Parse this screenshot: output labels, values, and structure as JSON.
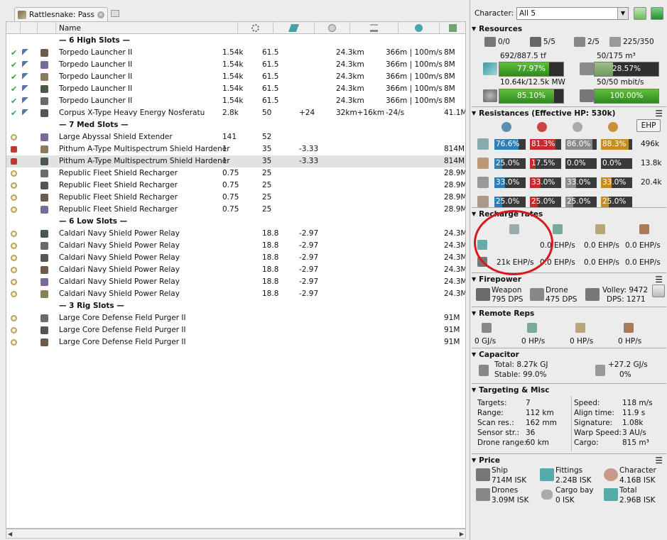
{
  "tab": {
    "title": "Rattlesnake: Pass"
  },
  "grid": {
    "columns": {
      "name": "Name"
    },
    "rows": [
      {
        "type": "header",
        "name": "— 6 High Slots —"
      },
      {
        "type": "mod",
        "state": "check",
        "name": "Torpedo Launcher II",
        "c1": "1.54k",
        "c2": "61.5",
        "c3": "",
        "c4": "24.3km",
        "c5": "366m | 100m/s",
        "c6": "8M"
      },
      {
        "type": "mod",
        "state": "check",
        "name": "Torpedo Launcher II",
        "c1": "1.54k",
        "c2": "61.5",
        "c3": "",
        "c4": "24.3km",
        "c5": "366m | 100m/s",
        "c6": "8M"
      },
      {
        "type": "mod",
        "state": "check",
        "name": "Torpedo Launcher II",
        "c1": "1.54k",
        "c2": "61.5",
        "c3": "",
        "c4": "24.3km",
        "c5": "366m | 100m/s",
        "c6": "8M"
      },
      {
        "type": "mod",
        "state": "check",
        "name": "Torpedo Launcher II",
        "c1": "1.54k",
        "c2": "61.5",
        "c3": "",
        "c4": "24.3km",
        "c5": "366m | 100m/s",
        "c6": "8M"
      },
      {
        "type": "mod",
        "state": "check",
        "name": "Torpedo Launcher II",
        "c1": "1.54k",
        "c2": "61.5",
        "c3": "",
        "c4": "24.3km",
        "c5": "366m | 100m/s",
        "c6": "8M"
      },
      {
        "type": "mod",
        "state": "check",
        "name": "Corpus X-Type Heavy Energy Nosferatu",
        "c1": "2.8k",
        "c2": "50",
        "c3": "+24",
        "c4": "32km+16km",
        "c5": "-24/s",
        "c6": "41.1M"
      },
      {
        "type": "header",
        "name": "— 7 Med Slots —"
      },
      {
        "type": "mod",
        "state": "online",
        "name": "Large Abyssal Shield Extender",
        "c1": "141",
        "c2": "52",
        "c3": "",
        "c4": "",
        "c5": "",
        "c6": ""
      },
      {
        "type": "mod",
        "state": "active",
        "name": "Pithum A-Type Multispectrum Shield Hardener",
        "c1": "1",
        "c2": "35",
        "c3": "-3.33",
        "c4": "",
        "c5": "",
        "c6": "814M"
      },
      {
        "type": "mod",
        "state": "active",
        "selected": true,
        "name": "Pithum A-Type Multispectrum Shield Hardener",
        "c1": "1",
        "c2": "35",
        "c3": "-3.33",
        "c4": "",
        "c5": "",
        "c6": "814M"
      },
      {
        "type": "mod",
        "state": "online",
        "name": "Republic Fleet Shield Recharger",
        "c1": "0.75",
        "c2": "25",
        "c3": "",
        "c4": "",
        "c5": "",
        "c6": "28.9M"
      },
      {
        "type": "mod",
        "state": "online",
        "name": "Republic Fleet Shield Recharger",
        "c1": "0.75",
        "c2": "25",
        "c3": "",
        "c4": "",
        "c5": "",
        "c6": "28.9M"
      },
      {
        "type": "mod",
        "state": "online",
        "name": "Republic Fleet Shield Recharger",
        "c1": "0.75",
        "c2": "25",
        "c3": "",
        "c4": "",
        "c5": "",
        "c6": "28.9M"
      },
      {
        "type": "mod",
        "state": "online",
        "name": "Republic Fleet Shield Recharger",
        "c1": "0.75",
        "c2": "25",
        "c3": "",
        "c4": "",
        "c5": "",
        "c6": "28.9M"
      },
      {
        "type": "header",
        "name": "— 6 Low Slots —"
      },
      {
        "type": "mod",
        "state": "online",
        "name": "Caldari Navy Shield Power Relay",
        "c1": "",
        "c2": "18.8",
        "c3": "-2.97",
        "c4": "",
        "c5": "",
        "c6": "24.3M"
      },
      {
        "type": "mod",
        "state": "online",
        "name": "Caldari Navy Shield Power Relay",
        "c1": "",
        "c2": "18.8",
        "c3": "-2.97",
        "c4": "",
        "c5": "",
        "c6": "24.3M"
      },
      {
        "type": "mod",
        "state": "online",
        "name": "Caldari Navy Shield Power Relay",
        "c1": "",
        "c2": "18.8",
        "c3": "-2.97",
        "c4": "",
        "c5": "",
        "c6": "24.3M"
      },
      {
        "type": "mod",
        "state": "online",
        "name": "Caldari Navy Shield Power Relay",
        "c1": "",
        "c2": "18.8",
        "c3": "-2.97",
        "c4": "",
        "c5": "",
        "c6": "24.3M"
      },
      {
        "type": "mod",
        "state": "online",
        "name": "Caldari Navy Shield Power Relay",
        "c1": "",
        "c2": "18.8",
        "c3": "-2.97",
        "c4": "",
        "c5": "",
        "c6": "24.3M"
      },
      {
        "type": "mod",
        "state": "online",
        "name": "Caldari Navy Shield Power Relay",
        "c1": "",
        "c2": "18.8",
        "c3": "-2.97",
        "c4": "",
        "c5": "",
        "c6": "24.3M"
      },
      {
        "type": "header",
        "name": "— 3 Rig Slots —"
      },
      {
        "type": "mod",
        "state": "online",
        "name": "Large Core Defense Field Purger II",
        "c1": "",
        "c2": "",
        "c3": "",
        "c4": "",
        "c5": "",
        "c6": "91M"
      },
      {
        "type": "mod",
        "state": "online",
        "name": "Large Core Defense Field Purger II",
        "c1": "",
        "c2": "",
        "c3": "",
        "c4": "",
        "c5": "",
        "c6": "91M"
      },
      {
        "type": "mod",
        "state": "online",
        "name": "Large Core Defense Field Purger II",
        "c1": "",
        "c2": "",
        "c3": "",
        "c4": "",
        "c5": "",
        "c6": "91M"
      }
    ]
  },
  "character": {
    "label": "Character:",
    "value": "All 5"
  },
  "resources": {
    "title": "Resources",
    "hardpoints": [
      "0/0",
      "5/5",
      "2/5",
      "225/350"
    ],
    "cpu_label": "692/887.5 tf",
    "cpu_pct": "77.97%",
    "cpu_fill": 0.7797,
    "drone_bay_label": "50/175 m³",
    "drone_bay_pct": "28.57%",
    "drone_bay_fill": 0.2857,
    "pg_label": "10.64k/12.5k MW",
    "pg_pct": "85.10%",
    "pg_fill": 0.851,
    "bandwidth_label": "50/50 mbit/s",
    "bandwidth_pct": "100.00%",
    "bandwidth_fill": 1.0
  },
  "resistances": {
    "title": "Resistances (Effective HP: 530k)",
    "ehp_button": "EHP",
    "rows": [
      {
        "vals": [
          "76.6%",
          "81.3%",
          "86.0%",
          "88.3%"
        ],
        "fills": [
          0.766,
          0.813,
          0.86,
          0.883
        ],
        "hp": "496k"
      },
      {
        "vals": [
          "25.0%",
          "17.5%",
          "0.0%",
          "0.0%"
        ],
        "fills": [
          0.25,
          0.175,
          0.0,
          0.0
        ],
        "hp": "13.8k"
      },
      {
        "vals": [
          "33.0%",
          "33.0%",
          "33.0%",
          "33.0%"
        ],
        "fills": [
          0.33,
          0.33,
          0.33,
          0.33
        ],
        "hp": "20.4k"
      },
      {
        "vals": [
          "25.0%",
          "25.0%",
          "25.0%",
          "25.0%"
        ],
        "fills": [
          0.25,
          0.25,
          0.25,
          0.25
        ],
        "hp": ""
      }
    ]
  },
  "recharge": {
    "title": "Recharge rates",
    "row1": [
      "0.0 EHP/s",
      "0.0 EHP/s",
      "0.0 EHP/s"
    ],
    "row2": [
      "21k EHP/s",
      "0.0 EHP/s",
      "0.0 EHP/s",
      "0.0 EHP/s"
    ]
  },
  "firepower": {
    "title": "Firepower",
    "weapon_label": "Weapon",
    "weapon_dps": "795 DPS",
    "drone_label": "Drone",
    "drone_dps": "475 DPS",
    "volley": "Volley: 9472",
    "dps": "DPS: 1271"
  },
  "remote_reps": {
    "title": "Remote Reps",
    "vals": [
      "0 GJ/s",
      "0 HP/s",
      "0 HP/s",
      "0 HP/s"
    ]
  },
  "capacitor": {
    "title": "Capacitor",
    "total": "Total: 8.27k GJ",
    "stable": "Stable: 99.0%",
    "delta": "+27.2 GJ/s",
    "pct": "0%"
  },
  "targeting": {
    "title": "Targeting & Misc",
    "left": [
      [
        "Targets:",
        "7"
      ],
      [
        "Range:",
        "112 km"
      ],
      [
        "Scan res.:",
        "162 mm"
      ],
      [
        "Sensor str.:",
        "36"
      ],
      [
        "Drone range:",
        "60 km"
      ]
    ],
    "right": [
      [
        "Speed:",
        "118 m/s"
      ],
      [
        "Align time:",
        "11.9 s"
      ],
      [
        "Signature:",
        "1.08k"
      ],
      [
        "Warp Speed:",
        "3 AU/s"
      ],
      [
        "Cargo:",
        "815 m³"
      ]
    ]
  },
  "price": {
    "title": "Price",
    "ship_label": "Ship",
    "ship": "714M ISK",
    "fittings_label": "Fittings",
    "fittings": "2.24B ISK",
    "character_label": "Character",
    "character": "4.16B ISK",
    "drones_label": "Drones",
    "drones": "3.09M ISK",
    "cargo_label": "Cargo bay",
    "cargo": "0 ISK",
    "total_label": "Total",
    "total": "2.96B ISK"
  },
  "colors": {
    "em": "#2d7fb8",
    "thermal": "#c42b2b",
    "kinetic": "#8a8a8a",
    "explosive": "#c78c22",
    "green": "#3c9a2a",
    "annotation": "#d8181c"
  }
}
